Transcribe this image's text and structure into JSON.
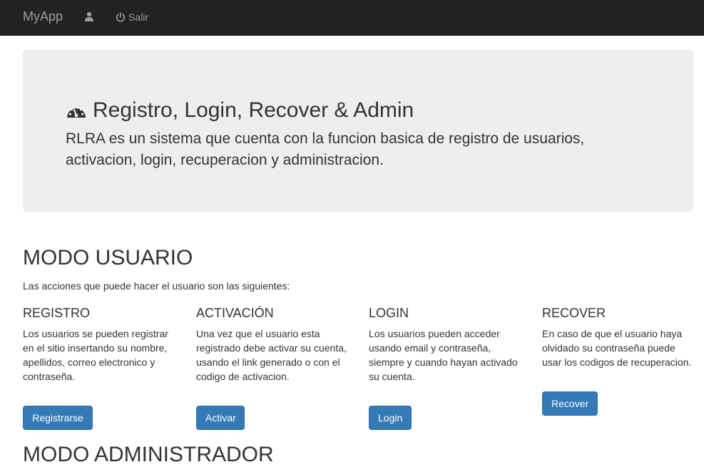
{
  "navbar": {
    "brand": "MyApp",
    "user_icon": "user-icon",
    "logout_icon": "power-icon",
    "logout_label": "Salir"
  },
  "jumbotron": {
    "icon": "dashboard-icon",
    "title": "Registro, Login, Recover & Admin",
    "lead": "RLRA es un sistema que cuenta con la funcion basica de registro de usuarios, activacion, login, recuperacion y administracion."
  },
  "modo_usuario": {
    "title": "MODO USUARIO",
    "intro": "Las acciones que puede hacer el usuario son las siguientes:",
    "columns": [
      {
        "heading": "REGISTRO",
        "text": "Los usuarios se pueden registrar en el sitio insertando su nombre, apellidos, correo electronico y contraseña.",
        "button": "Registrarse"
      },
      {
        "heading": "ACTIVACIÓN",
        "text": "Una vez que el usuario esta registrado debe activar su cuenta, usando el link generado o con el codigo de activacion.",
        "button": "Activar"
      },
      {
        "heading": "LOGIN",
        "text": "Los usuarios pueden acceder usando email y contraseña, siempre y cuando hayan activado su cuenta.",
        "button": "Login"
      },
      {
        "heading": "RECOVER",
        "text": "En caso de que el usuario haya olvidado su contraseña puede usar los codigos de recuperacion.",
        "button": "Recover"
      }
    ]
  },
  "modo_admin": {
    "title": "MODO ADMINISTRADOR"
  },
  "colors": {
    "navbar_bg": "#222222",
    "navbar_text": "#9d9d9d",
    "jumbotron_bg": "#eeeeee",
    "primary": "#337ab7"
  }
}
